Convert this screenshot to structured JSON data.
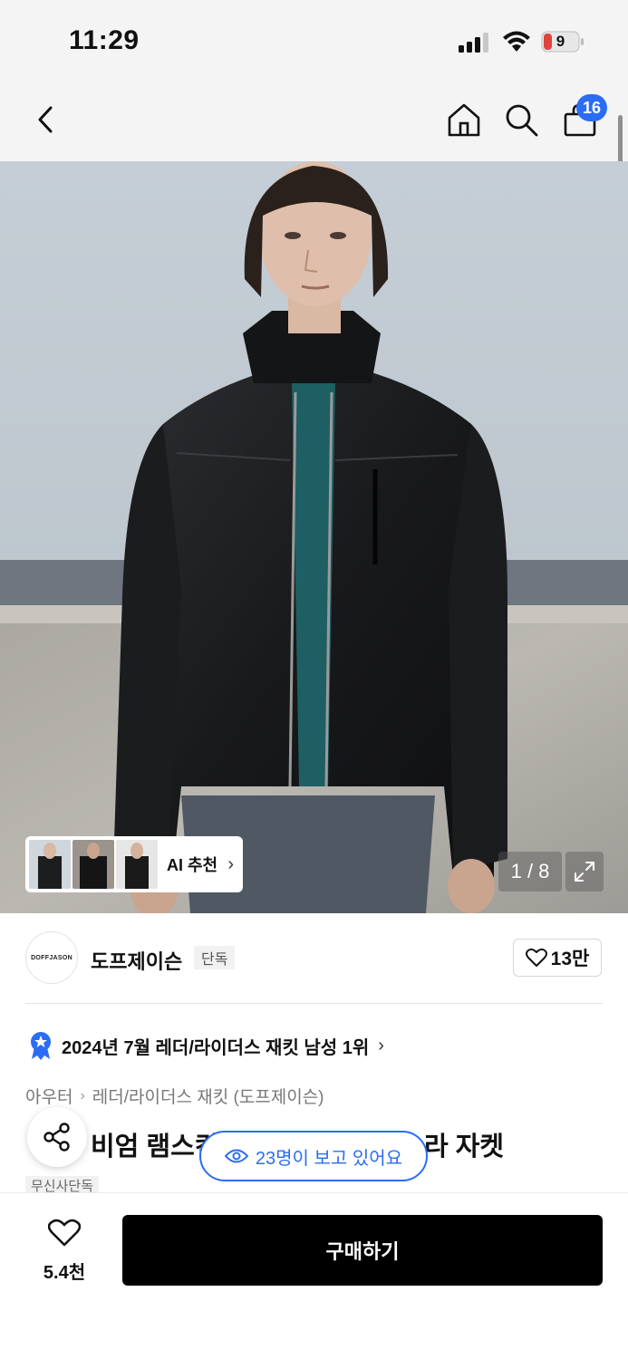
{
  "status_bar": {
    "time": "11:29",
    "battery": "9"
  },
  "nav": {
    "cart_count": "16"
  },
  "gallery": {
    "ai_label": "AI 추천",
    "page_indicator": "1 / 8"
  },
  "brand": {
    "logo_text": "DOFFJASON",
    "name": "도프제이슨",
    "tag": "단독",
    "likes": "13만"
  },
  "ranking": {
    "text": "2024년 7월 레더/라이더스 재킷 남성 1위"
  },
  "breadcrumb": {
    "items": [
      "아우터",
      "레더/라이더스 재킷 (도프제이슨)"
    ]
  },
  "product": {
    "title_visible_left": "비엄 램스킨",
    "title_visible_right": "라 자켓",
    "tag": "무신사단독"
  },
  "viewers": {
    "text": "23명이 보고 있어요"
  },
  "bottom": {
    "wish_count": "5.4천",
    "buy_label": "구매하기"
  },
  "colors": {
    "accent": "#2a6df4",
    "buy_button": "#000000"
  }
}
